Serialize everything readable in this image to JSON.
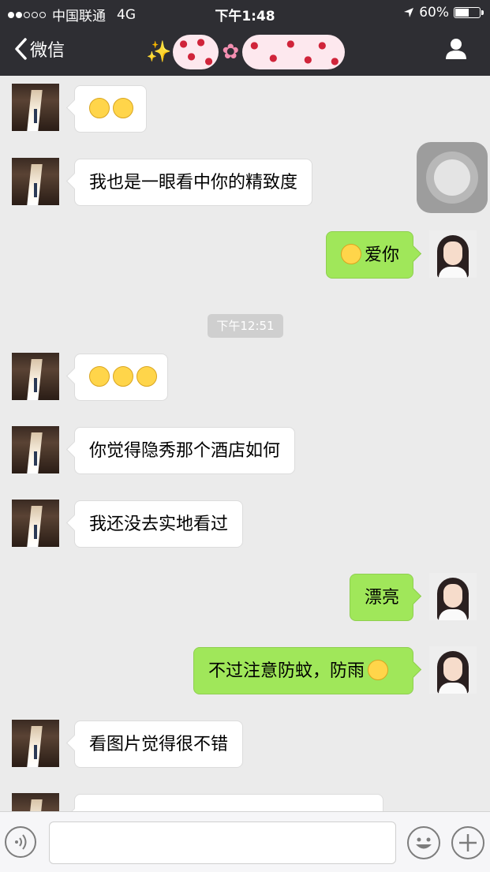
{
  "status_bar": {
    "carrier": "中国联通",
    "network": "4G",
    "time": "下午1:48",
    "battery_percent": "60%",
    "battery_level": 0.6,
    "signal_filled": 2,
    "signal_total": 5
  },
  "nav": {
    "back_label": "微信"
  },
  "chat": {
    "timestamp": "下午12:51",
    "messages": [
      {
        "side": "in",
        "text": "",
        "emoji_count": 2,
        "emoji": "grinning-emoji"
      },
      {
        "side": "in",
        "text": "我也是一眼看中你的精致度"
      },
      {
        "side": "out",
        "text": "爱你",
        "emoji": "kiss-emoji"
      },
      {
        "side": "in",
        "text": "",
        "emoji_count": 3,
        "emoji": "grimace-emoji"
      },
      {
        "side": "in",
        "text": "你觉得隐秀那个酒店如何"
      },
      {
        "side": "in",
        "text": "我还没去实地看过"
      },
      {
        "side": "out",
        "text": "漂亮"
      },
      {
        "side": "out",
        "text": "不过注意防蚊，防雨",
        "emoji": "shy-emoji"
      },
      {
        "side": "in",
        "text": "看图片觉得很不错"
      }
    ]
  },
  "colors": {
    "topbar": "#2e2e33",
    "chat_bg": "#ebebeb",
    "out_bubble": "#a0e75a",
    "in_bubble": "#ffffff"
  },
  "icons": {
    "back": "chevron-left-icon",
    "profile": "person-icon",
    "voice": "voice-icon",
    "emoji": "smiley-icon",
    "more": "plus-icon"
  }
}
